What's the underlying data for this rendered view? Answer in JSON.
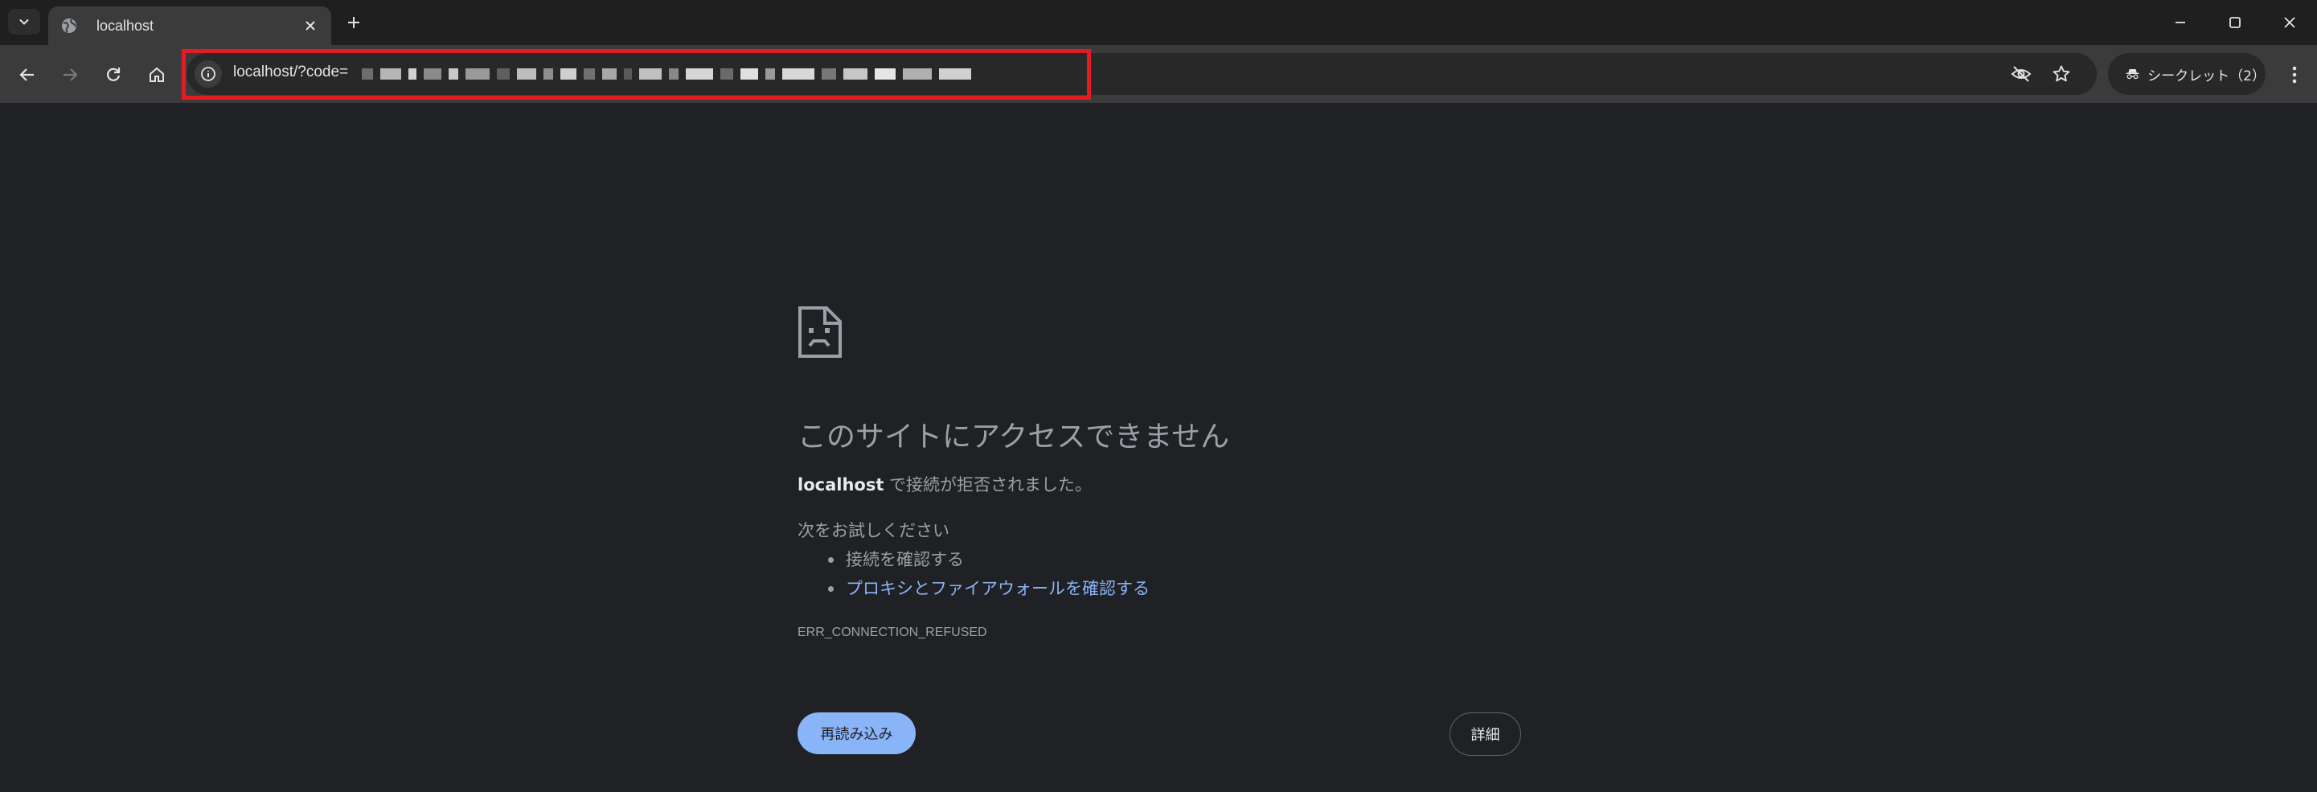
{
  "tabs": [
    {
      "title": "localhost",
      "icon": "globe-icon",
      "active": true
    }
  ],
  "toolbar": {
    "url_visible": "localhost/?code=",
    "url_redacted": true,
    "incognito_label": "シークレット（2）"
  },
  "error_page": {
    "heading": "このサイトにアクセスできません",
    "host": "localhost",
    "description_suffix": " で接続が拒否されました。",
    "suggestions_title": "次をお試しください",
    "suggestions": [
      {
        "text": "接続を確認する",
        "is_link": false
      },
      {
        "text": "プロキシとファイアウォールを確認する",
        "is_link": true
      }
    ],
    "error_code": "ERR_CONNECTION_REFUSED",
    "reload_label": "再読み込み",
    "details_label": "詳細"
  },
  "colors": {
    "accent_blue": "#8ab4f8",
    "highlight_red": "#e31b23",
    "page_bg": "#202124",
    "toolbar_bg": "#3b3b3b"
  }
}
